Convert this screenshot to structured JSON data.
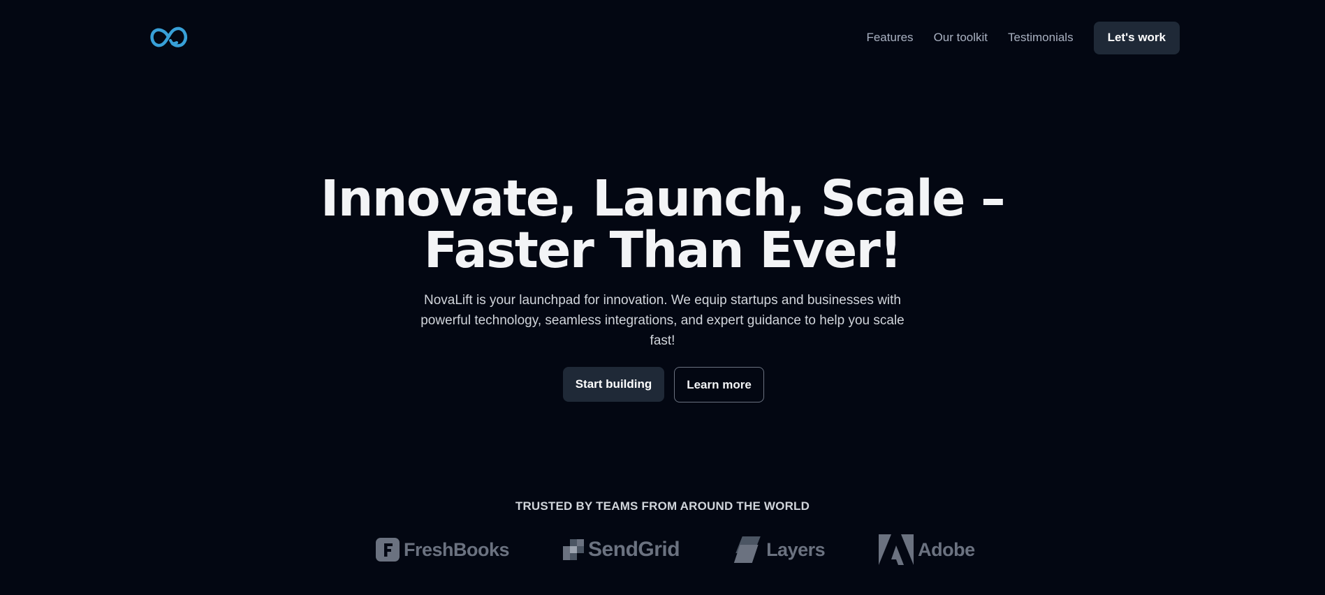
{
  "header": {
    "logo_icon": "infinity-logo-icon",
    "nav": [
      {
        "label": "Features"
      },
      {
        "label": "Our toolkit"
      },
      {
        "label": "Testimonials"
      }
    ],
    "cta_label": "Let's work"
  },
  "hero": {
    "title_line1": "Innovate, Launch, Scale –",
    "title_line2": "Faster Than Ever!",
    "subtitle": "NovaLift is your launchpad for innovation. We equip startups and businesses with powerful technology, seamless integrations, and expert guidance to help you scale fast!",
    "primary_button": "Start building",
    "secondary_button": "Learn more"
  },
  "trusted": {
    "label": "TRUSTED BY TEAMS FROM AROUND THE WORLD",
    "logos": [
      {
        "name": "FreshBooks",
        "icon": "freshbooks-icon"
      },
      {
        "name": "SendGrid",
        "icon": "sendgrid-icon"
      },
      {
        "name": "Layers",
        "icon": "layers-icon"
      },
      {
        "name": "Adobe",
        "icon": "adobe-icon"
      }
    ]
  },
  "colors": {
    "background": "#030712",
    "accent_logo": "#38a0d8",
    "button_dark": "#1f2937",
    "muted_logo": "#6b7280"
  }
}
